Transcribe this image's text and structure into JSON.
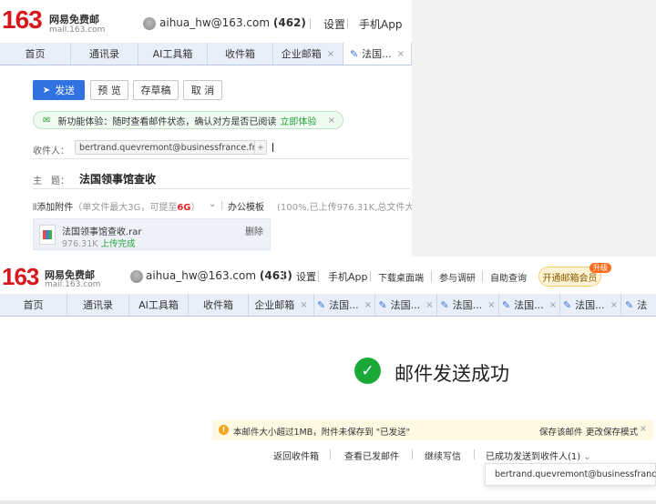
{
  "top": {
    "logo_number": "163",
    "logo_cn": "网易免费邮",
    "logo_domain": "mail.163.com",
    "account": "aihua_hw@163.com",
    "unread_count": "(462)",
    "settings": "设置",
    "mobile_app": "手机App",
    "tabs": [
      {
        "label": "首页"
      },
      {
        "label": "通讯录"
      },
      {
        "label": "AI工具箱"
      },
      {
        "label": "收件箱"
      },
      {
        "label": "企业邮箱",
        "close": "×"
      },
      {
        "label": "法国...",
        "close": "×"
      }
    ],
    "buttons": {
      "send": "发送",
      "preview": "预 览",
      "draft": "存草稿",
      "cancel": "取 消"
    },
    "notice": {
      "text": "新功能体验：随时查看邮件状态，确认对方是否已阅读",
      "link": "立即体验",
      "close": "×"
    },
    "recipient_label": "收件人：",
    "recipient": "bertrand.quevremont@businessfrance.fr",
    "add_symbol": "+",
    "subject_label": "主　题：",
    "subject": "法国领事馆查收",
    "attach": {
      "add": "添加附件",
      "limit": "（单文件最大3G，",
      "upgrade_prefix": "可提至",
      "upgrade_value": "6G",
      "upgrade_suffix": "）",
      "office": "办公模板",
      "status": "(100%,已上传976.31K,总文件大小"
    },
    "file": {
      "name": "法国领事馆查收.rar",
      "size": "976.31K",
      "state": "上传完成",
      "delete": "删除"
    }
  },
  "bottom": {
    "logo_number": "163",
    "logo_cn": "网易免费邮",
    "logo_domain": "mail.163.com",
    "account": "aihua_hw@163.com",
    "unread_count": "(463)",
    "settings": "设置",
    "mobile_app": "手机App",
    "download": "下载桌面端",
    "survey": "参与调研",
    "self_service": "自助查询",
    "vip": "开通邮箱会员",
    "vip_badge": "升级",
    "tabs": [
      {
        "label": "首页"
      },
      {
        "label": "通讯录"
      },
      {
        "label": "AI工具箱"
      },
      {
        "label": "收件箱"
      },
      {
        "label": "企业邮箱",
        "close": "×"
      },
      {
        "label": "法国...",
        "close": "×"
      },
      {
        "label": "法国...",
        "close": "×"
      },
      {
        "label": "法国...",
        "close": "×"
      },
      {
        "label": "法国...",
        "close": "×"
      },
      {
        "label": "法国...",
        "close": "×"
      },
      {
        "label": "法国...",
        "close": "×"
      },
      {
        "label": "法"
      }
    ],
    "success": "邮件发送成功",
    "warning": {
      "icon": "!",
      "text": "本邮件大小超过1MB，附件未保存到 \"已发送\"",
      "save_mail": "保存该邮件",
      "change_mode": "更改保存模式",
      "close": "×"
    },
    "links": {
      "inbox": "返回收件箱",
      "sent": "查看已发邮件",
      "continue": "继续写信",
      "delivered": "已成功发送到收件人(1)"
    },
    "dropdown_recipient": "bertrand.quevremont@businessfrance.fr"
  },
  "colors": {
    "brand_red": "#d8161b",
    "accent_blue": "#2f72e0",
    "success_green": "#1aa838",
    "warning_orange": "#f6a623"
  }
}
